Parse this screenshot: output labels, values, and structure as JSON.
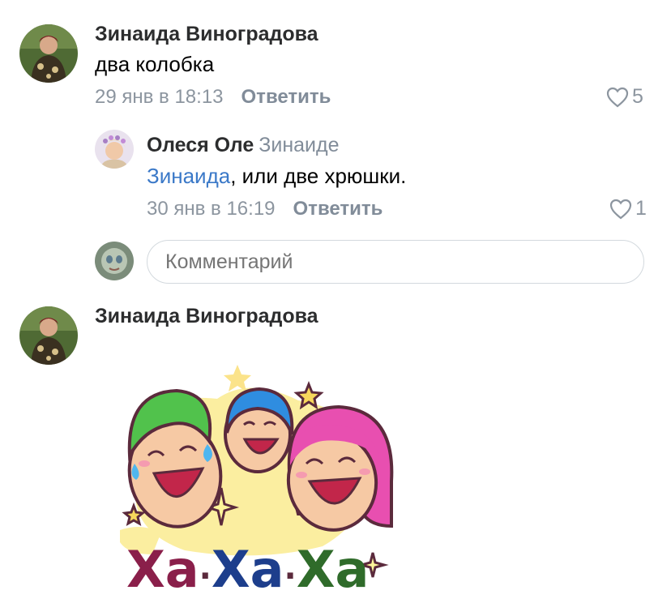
{
  "comments": [
    {
      "author": "Зинаида Виноградова",
      "text": "два колобка",
      "date": "29 янв в 18:13",
      "reply_label": "Ответить",
      "likes": "5"
    },
    {
      "author": "Олеся Оле",
      "reply_to": "Зинаиде",
      "mention": "Зинаида",
      "text_rest": ", или две хрюшки.",
      "date": "30 янв в 16:19",
      "reply_label": "Ответить",
      "likes": "1"
    },
    {
      "author": "Зинаида Виноградова",
      "sticker_text": "Ха-Ха-Ха"
    }
  ],
  "comment_input": {
    "placeholder": "Комментарий"
  },
  "icons": {
    "like": "heart-outline-icon"
  },
  "colors": {
    "author": "#2c2d2e",
    "meta": "#8c959f",
    "mention": "#3b79c8",
    "input_border": "#d3d9de"
  }
}
